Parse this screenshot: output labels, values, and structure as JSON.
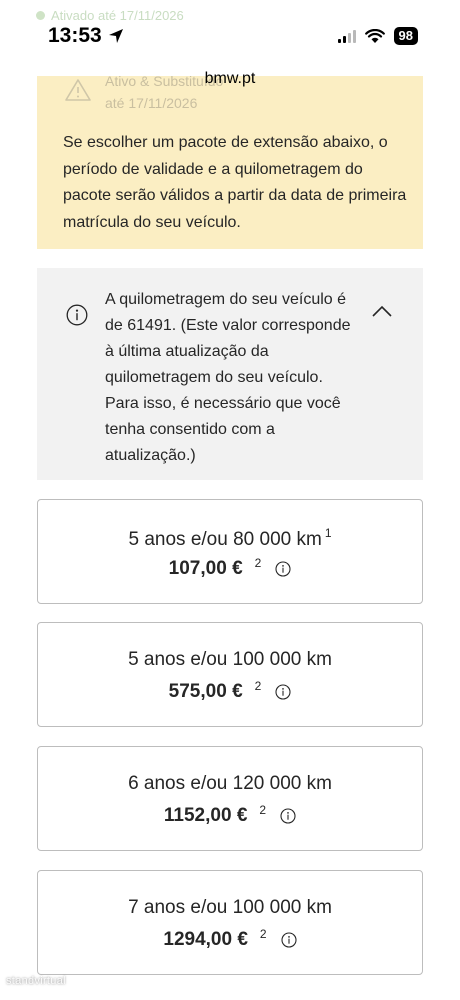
{
  "status_bar": {
    "time": "13:53",
    "battery": "98",
    "behind_text": "Ativado até 17/11/2026"
  },
  "browser": {
    "url": "bmw.pt"
  },
  "warning": {
    "faded_title": "Ativo & Substituído",
    "faded_date": "até 17/11/2026",
    "text": "Se escolher um pacote de extensão abaixo, o período de validade e a quilometragem do pacote serão válidos a partir da data de primeira matrícula do seu veículo.",
    "color": "#fbeec3"
  },
  "info": {
    "text": "A quilometragem do seu veículo é de 61491. (Este valor corresponde à última atualização da quilometragem do seu veículo. Para isso, é necessário que você tenha consentido com a atualização.)",
    "color": "#f2f2f2"
  },
  "packages": [
    {
      "title": "5 anos e/ou 80 000 km",
      "title_ref": "1",
      "price": "107,00 €",
      "price_ref": "2"
    },
    {
      "title": "5 anos e/ou 100 000 km",
      "title_ref": "",
      "price": "575,00 €",
      "price_ref": "2"
    },
    {
      "title": "6 anos e/ou 120 000 km",
      "title_ref": "",
      "price": "1152,00 €",
      "price_ref": "2"
    },
    {
      "title": "7 anos e/ou 100 000 km",
      "title_ref": "",
      "price": "1294,00 €",
      "price_ref": "2"
    }
  ],
  "watermark": "standvirtual",
  "icons": {
    "warning": "warning-triangle-icon",
    "info": "info-circle-icon",
    "collapse": "chevron-up-icon",
    "location": "location-arrow-icon",
    "wifi": "wifi-icon",
    "signal": "signal-icon"
  }
}
